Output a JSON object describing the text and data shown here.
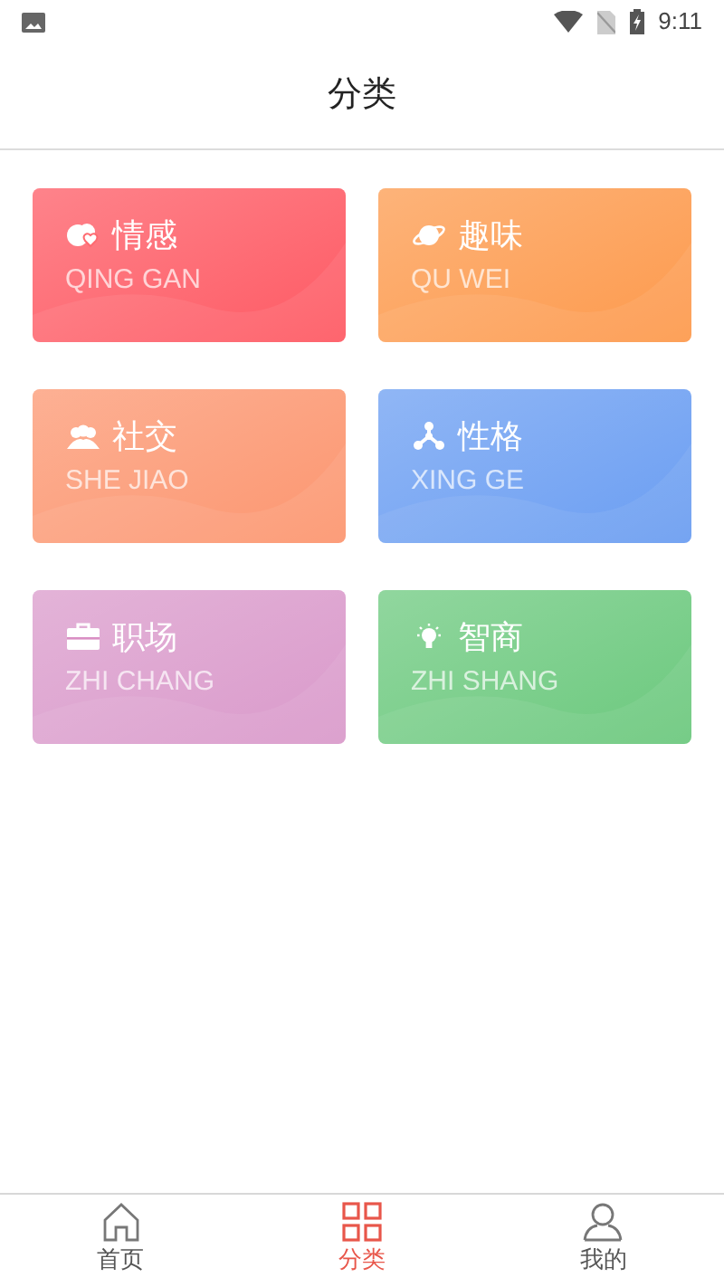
{
  "status_bar": {
    "time": "9:11"
  },
  "header": {
    "title": "分类"
  },
  "categories": [
    {
      "title": "情感",
      "subtitle": "QING GAN",
      "color": "#fe5a64"
    },
    {
      "title": "趣味",
      "subtitle": "QU WEI",
      "color": "#fd9a4d"
    },
    {
      "title": "社交",
      "subtitle": "SHE JIAO",
      "color": "#fc9670"
    },
    {
      "title": "性格",
      "subtitle": "XING GE",
      "color": "#6b9ef2"
    },
    {
      "title": "职场",
      "subtitle": "ZHI CHANG",
      "color": "#da9acb"
    },
    {
      "title": "智商",
      "subtitle": "ZHI SHANG",
      "color": "#6cc97e"
    }
  ],
  "tab_bar": [
    {
      "label": "首页",
      "selected": false
    },
    {
      "label": "分类",
      "selected": true
    },
    {
      "label": "我的",
      "selected": false
    }
  ]
}
